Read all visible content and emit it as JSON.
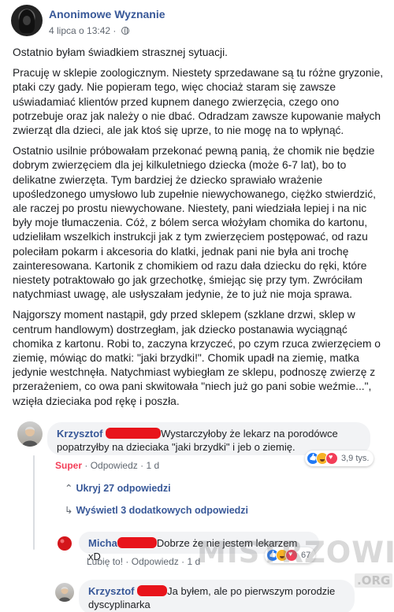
{
  "page": {
    "name": "Anonimowe Wyznanie",
    "date": "4 lipca o 13:42",
    "dot": "·"
  },
  "post": {
    "paragraphs": [
      "Ostatnio byłam świadkiem strasznej sytuacji.",
      "Pracuję w sklepie zoologicznym. Niestety sprzedawane są tu różne gryzonie, ptaki czy gady. Nie popieram tego, więc chociaż staram się zawsze uświadamiać klientów przed kupnem danego zwierzęcia, czego ono potrzebuje oraz jak należy o nie dbać. Odradzam zawsze kupowanie małych zwierząt dla dzieci, ale jak ktoś się uprze, to nie mogę na to wpłynąć.",
      "Ostatnio usilnie próbowałam przekonać pewną panią, że chomik nie będzie dobrym zwierzęciem dla jej kilkuletniego dziecka (może 6-7 lat), bo to delikatne zwierzęta. Tym bardziej że dziecko sprawiało wrażenie upośledzonego umysłowo lub zupełnie niewychowanego, ciężko stwierdzić, ale raczej po prostu niewychowane. Niestety, pani wiedziała lepiej i na nic były moje tłumaczenia. Cóż, z bólem serca włożyłam chomika do kartonu, udzieliłam wszelkich instrukcji jak z tym zwierzęciem postępować, od razu poleciłam pokarm i akcesoria do klatki, jednak pani nie była ani trochę zainteresowana. Kartonik z chomikiem od razu dała dziecku do ręki, które niestety potraktowało go jak grzechotkę, śmiejąc się przy tym. Zwróciłam natychmiast uwagę, ale usłyszałam jedynie, że to już nie moja sprawa.",
      "Najgorszy moment nastąpił, gdy przed sklepem (szklane drzwi, sklep w centrum handlowym) dostrzegłam, jak dziecko postanawia wyciągnąć chomika z kartonu. Robi to, zaczyna krzyczeć, po czym rzuca zwierzęciem o ziemię, mówiąc do matki: \"jaki brzydki!\". Chomik upadł na ziemię, matka jedynie westchnęła. Natychmiast wybiegłam ze sklepu, podnoszę zwierzę z przerażeniem, co owa pani skwitowała \"niech już go pani sobie weźmie...\", wzięła dzieciaka pod rękę i poszła."
    ]
  },
  "comments": [
    {
      "author": "Krzysztof",
      "text": "Wystarczyłoby że lekarz na porodówce popatrzyłby na dzieciaka \"jaki brzydki\" i jeb o ziemię.",
      "reacted_label": "Super",
      "reply_label": "Odpowiedz",
      "time": "1 d",
      "reaction_count": "3,9 tys."
    },
    {
      "author": "Micha",
      "text": "Dobrze że nie jestem lekarzem xD",
      "like_label": "Lubię to!",
      "reply_label": "Odpowiedz",
      "time": "1 d",
      "reaction_count": "67"
    },
    {
      "author": "Krzysztof",
      "text": "Ja byłem, ale po pierwszym porodzie dyscyplinarka"
    }
  ],
  "thread": {
    "hide_label": "Ukryj 27 odpowiedzi",
    "more_label": "Wyświetl 3 dodatkowych odpowiedzi"
  },
  "separator": "·",
  "watermark": {
    "text": "MISTRZOWIE",
    "suffix": ".ORG"
  },
  "colors": {
    "link_blue": "#385898",
    "redaction": "#e8141b",
    "bubble": "#f2f3f5",
    "love_red": "#f33e58"
  },
  "icons": [
    "globe-icon",
    "like-reaction-icon",
    "haha-reaction-icon",
    "love-reaction-icon",
    "reply-arrow-icon"
  ]
}
